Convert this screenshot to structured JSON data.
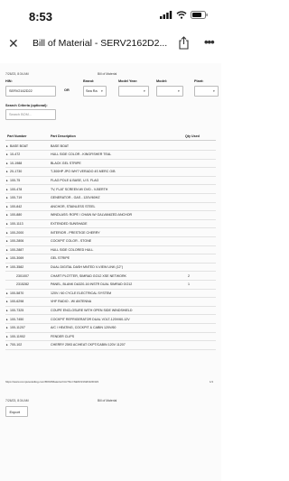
{
  "status": {
    "time": "8:53"
  },
  "nav": {
    "title": "Bill of Material - SERV2162D2..."
  },
  "header": {
    "timestamp": "7/26/23, 8:34 AM",
    "doc_title": "Bill of Material"
  },
  "form": {
    "hin_label": "HIN:",
    "hin_value": "SERV2162D22",
    "or_label": "OR",
    "brand_label": "Brand:",
    "brand_value": "Sea Ra",
    "model_year_label": "Model Year:",
    "model_label": "Model:",
    "plant_label": "Plant:",
    "search_criteria_label": "Search Criteria (optional):",
    "search_placeholder": "Search BOM..."
  },
  "table": {
    "headers": {
      "part_number": "Part Number",
      "part_description": "Part Description",
      "qty": "Qty Used"
    },
    "rows": [
      {
        "expander": "▸",
        "part": "BASE BOAT",
        "desc": "BASE BOAT",
        "qty": ""
      },
      {
        "expander": "▸",
        "part": "10-472",
        "desc": "HULL SIDE COLOR - KINGFISHER TEAL",
        "qty": ""
      },
      {
        "expander": "▸",
        "part": "10-1988",
        "desc": "BLACK GEL STRIPE",
        "qty": ""
      },
      {
        "expander": "▸",
        "part": "20-1730",
        "desc": "T-300HP JPO WHT VERADO 4S MERC O/B",
        "qty": ""
      },
      {
        "expander": "▸",
        "part": "100-75",
        "desc": "FLAG POLE & BASE, U.S. FLAG",
        "qty": ""
      },
      {
        "expander": "▸",
        "part": "100-478",
        "desc": "TV, FLAT SCREEN W/ DVD - V-BERTH",
        "qty": ""
      },
      {
        "expander": "▸",
        "part": "100-719",
        "desc": "GENERATOR - GAS - 120V/60HZ",
        "qty": ""
      },
      {
        "expander": "▸",
        "part": "100-842",
        "desc": "ANCHOR, STAINLESS STEEL",
        "qty": ""
      },
      {
        "expander": "▸",
        "part": "100-880",
        "desc": "WINDLASS: ROPE / CHAIN W/ GALVANIZED ANCHOR",
        "qty": ""
      },
      {
        "expander": "▸",
        "part": "100-1113",
        "desc": "EXTENDED SUNSHADE",
        "qty": ""
      },
      {
        "expander": "▸",
        "part": "100-2000",
        "desc": "INTERIOR - PRESTIGE CHERRY",
        "qty": ""
      },
      {
        "expander": "▸",
        "part": "100-2806",
        "desc": "COCKPIT COLOR - STONE",
        "qty": ""
      },
      {
        "expander": "▸",
        "part": "100-2887",
        "desc": "HULL SIDE COLORED HULL",
        "qty": ""
      },
      {
        "expander": "▸",
        "part": "100-3069",
        "desc": "GEL STRIPE",
        "qty": ""
      },
      {
        "expander": "▾",
        "part": "100-3582",
        "desc": "DUAL DIGITAL DASH MNTED V-VIEW LINK (12\")",
        "qty": ""
      },
      {
        "expander": "",
        "part": "2301007",
        "desc": "CHART PLOTTER, SIMRAD GO12 XSE NETWORK",
        "qty": "2"
      },
      {
        "expander": "",
        "part": "2315282",
        "desc": "PANEL, BLANK DA320-16 INSTR DUAL SIMRAD GO12",
        "qty": "1"
      },
      {
        "expander": "▸",
        "part": "100-5870",
        "desc": "120V / 60 CYCLE ELECTRICAL SYSTEM",
        "qty": ""
      },
      {
        "expander": "▸",
        "part": "100-6298",
        "desc": "VHF RADIO - W/ ANTENNA",
        "qty": ""
      },
      {
        "expander": "▸",
        "part": "100-7325",
        "desc": "COUPE ENCLOSURE WITH OPEN SIDE WINDSHIELD",
        "qty": ""
      },
      {
        "expander": "▸",
        "part": "100-7450",
        "desc": "COCKPIT REFRIGERATOR DUAL VOLT-120V/60-12V",
        "qty": ""
      },
      {
        "expander": "▸",
        "part": "100-11207",
        "desc": "A/C / HEATING, COCKPIT & CABIN 120V/60",
        "qty": ""
      },
      {
        "expander": "▸",
        "part": "100-11902",
        "desc": "FENDER CLIPS",
        "qty": ""
      },
      {
        "expander": "▸",
        "part": "700-102",
        "desc": "CHERRY 2593 AC/HEAT CKPT/CABIN 120V 11207",
        "qty": ""
      }
    ]
  },
  "footer": {
    "url": "https://www.computeraidlog.com/BOM/Material.htm?hin=SERV2162D22D323",
    "page": "1/1",
    "timestamp": "7/26/23, 8:34 AM",
    "doc_title": "Bill of Material",
    "export_label": "Export"
  },
  "colors": {
    "row_divider": "#e2e2e2",
    "accent": "#111111"
  }
}
